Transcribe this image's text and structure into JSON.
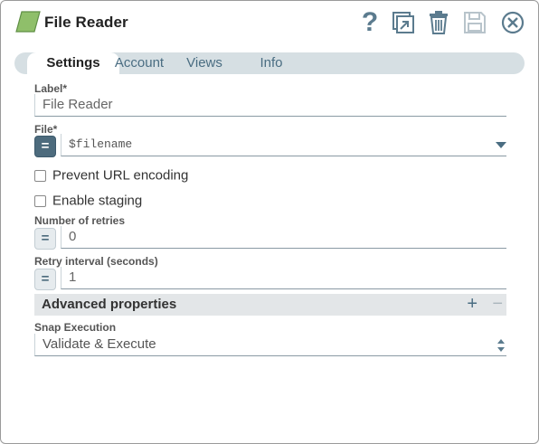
{
  "header": {
    "title": "File Reader",
    "help_glyph": "?",
    "icons": [
      "snap-parallelogram-icon",
      "help-icon",
      "expand-icon",
      "delete-icon",
      "save-icon",
      "close-icon"
    ],
    "accent_color": "#5b7b8e",
    "snap_icon_color": "#8fbf6a"
  },
  "tabs": [
    {
      "label": "Settings",
      "active": true
    },
    {
      "label": "Account",
      "active": false
    },
    {
      "label": "Views",
      "active": false
    },
    {
      "label": "Info",
      "active": false
    }
  ],
  "form": {
    "label_field": {
      "label": "Label*",
      "value": "File Reader"
    },
    "file_field": {
      "label": "File*",
      "value": "$filename",
      "expression_enabled": true
    },
    "prevent_url_encoding": {
      "label": "Prevent URL encoding",
      "checked": false
    },
    "enable_staging": {
      "label": "Enable staging",
      "checked": false
    },
    "number_of_retries": {
      "label": "Number of retries",
      "value": "0",
      "expression_enabled": false
    },
    "retry_interval": {
      "label": "Retry interval (seconds)",
      "value": "1",
      "expression_enabled": false
    },
    "expression_glyph": "="
  },
  "advanced": {
    "title": "Advanced properties",
    "add_glyph": "+",
    "remove_glyph": "−"
  },
  "snap_execution": {
    "label": "Snap Execution",
    "value": "Validate & Execute"
  }
}
